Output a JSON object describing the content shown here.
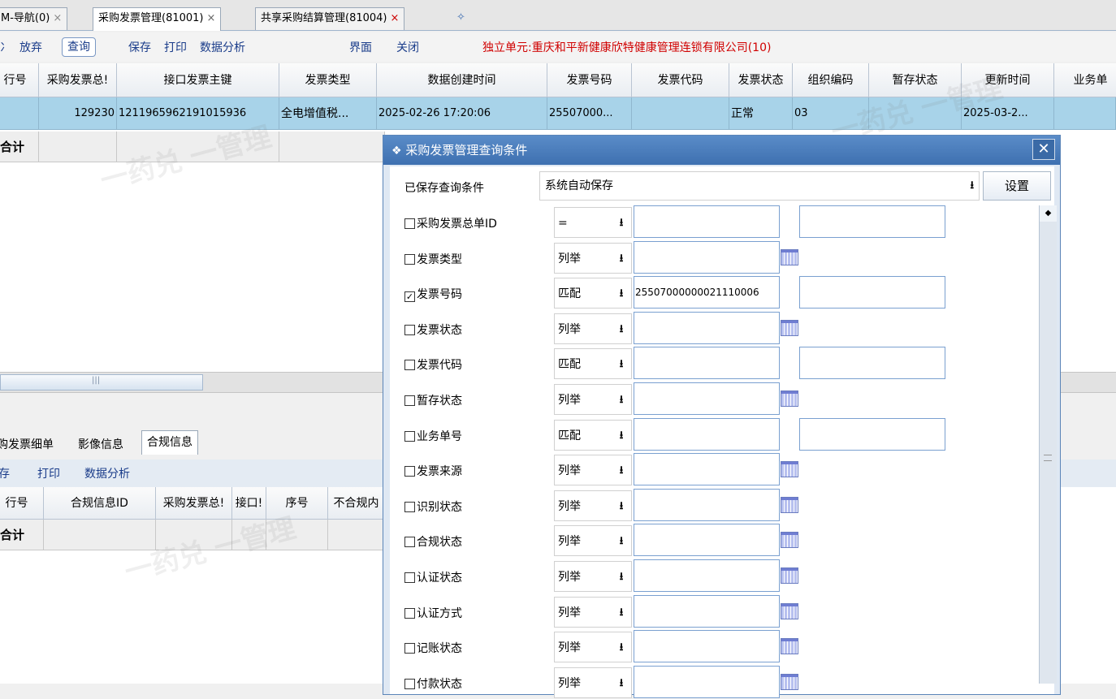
{
  "tabs": [
    {
      "label": "M-导航(0)",
      "close": "×"
    },
    {
      "label": "采购发票管理(81001)",
      "close": "×"
    },
    {
      "label": "共享采购结算管理(81004)",
      "close": "×"
    },
    {
      "label": "✧",
      "close": ""
    }
  ],
  "toolbar": {
    "cut_label": "冫",
    "abandon": "放弃",
    "query": "查询",
    "save": "保存",
    "print": "打印",
    "analysis": "数据分析",
    "interface": "界面",
    "close": "关闭",
    "unit_text": "独立单元:重庆和平新健康欣特健康管理连锁有限公司(10)"
  },
  "main_table": {
    "headers": [
      "行号",
      "采购发票总!",
      "接口发票主键",
      "发票类型",
      "数据创建时间",
      "发票号码",
      "发票代码",
      "发票状态",
      "组织编码",
      "暂存状态",
      "更新时间",
      "业务单"
    ],
    "row": [
      "",
      "129230",
      "1211965962191015936",
      "全电增值税...",
      "2025-02-26 17:20:06",
      "25507000...",
      "",
      "正常",
      "03",
      "",
      "2025-03-2...",
      ""
    ],
    "total_label": "合计"
  },
  "scroll_thumb_text": "|||",
  "bottom_tabs": [
    "购发票细单",
    "影像信息",
    "合规信息"
  ],
  "toolbar2": {
    "save": "存",
    "print": "打印",
    "analysis": "数据分析"
  },
  "sub_table": {
    "headers": [
      "行号",
      "合规信息ID",
      "采购发票总!",
      "接口!",
      "序号",
      "不合规内"
    ],
    "total_label": "合计"
  },
  "watermark_text": "一药兑 一管理",
  "dialog": {
    "title": "采购发票管理查询条件",
    "close": "✕",
    "saved_label": "已保存查询条件",
    "saved_value": "系统自动保存",
    "settings": "设置",
    "conditions": [
      {
        "label": "采购发票总单ID",
        "checked": false,
        "op": "=",
        "value": "",
        "second": true,
        "calendar": false
      },
      {
        "label": "发票类型",
        "checked": false,
        "op": "列举",
        "value": "",
        "second": false,
        "calendar": true
      },
      {
        "label": "发票号码",
        "checked": true,
        "op": "匹配",
        "value": "25507000000021110006",
        "second": true,
        "calendar": false
      },
      {
        "label": "发票状态",
        "checked": false,
        "op": "列举",
        "value": "",
        "second": false,
        "calendar": true
      },
      {
        "label": "发票代码",
        "checked": false,
        "op": "匹配",
        "value": "",
        "second": true,
        "calendar": false
      },
      {
        "label": "暂存状态",
        "checked": false,
        "op": "列举",
        "value": "",
        "second": false,
        "calendar": true
      },
      {
        "label": "业务单号",
        "checked": false,
        "op": "匹配",
        "value": "",
        "second": true,
        "calendar": false
      },
      {
        "label": "发票来源",
        "checked": false,
        "op": "列举",
        "value": "",
        "second": false,
        "calendar": true
      },
      {
        "label": "识别状态",
        "checked": false,
        "op": "列举",
        "value": "",
        "second": false,
        "calendar": true
      },
      {
        "label": "合规状态",
        "checked": false,
        "op": "列举",
        "value": "",
        "second": false,
        "calendar": true
      },
      {
        "label": "认证状态",
        "checked": false,
        "op": "列举",
        "value": "",
        "second": false,
        "calendar": true
      },
      {
        "label": "认证方式",
        "checked": false,
        "op": "列举",
        "value": "",
        "second": false,
        "calendar": true
      },
      {
        "label": "记账状态",
        "checked": false,
        "op": "列举",
        "value": "",
        "second": false,
        "calendar": true
      },
      {
        "label": "付款状态",
        "checked": false,
        "op": "列举",
        "value": "",
        "second": false,
        "calendar": true
      }
    ]
  }
}
